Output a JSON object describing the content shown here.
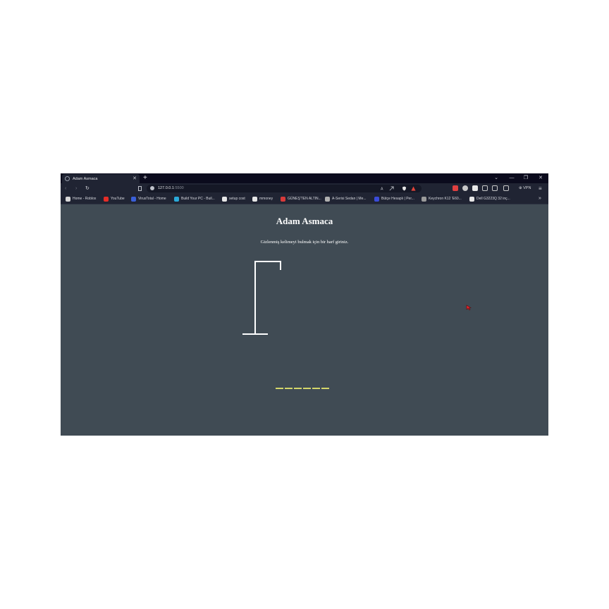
{
  "browser": {
    "tab_title": "Adam Asmaca",
    "tab_close": "✕",
    "new_tab": "+",
    "window_controls": [
      "⌄",
      "—",
      "❐",
      "✕"
    ],
    "url_host": "127.0.0.1",
    "url_port": ":5500",
    "vpn_label": "⊕ VPN",
    "menu_icon": "≡",
    "nav": {
      "back": "‹",
      "forward": "›",
      "reload": "↻"
    }
  },
  "bookmarks": [
    {
      "label": "Home - Roblox",
      "icon_color": "#d8d8d8"
    },
    {
      "label": "YouTube",
      "icon_color": "#e52d27"
    },
    {
      "label": "VirusTotal - Home",
      "icon_color": "#3a5fd8"
    },
    {
      "label": "Build Your PC - Buil...",
      "icon_color": "#2aa9d8"
    },
    {
      "label": "setup cost",
      "icon_color": "#e6e6e6"
    },
    {
      "label": "mmoney",
      "icon_color": "#e6e6e6"
    },
    {
      "label": "GÜNEŞ'TEN ALTIN...",
      "icon_color": "#d83a3a"
    },
    {
      "label": "A-Serisi Sedan | Me...",
      "icon_color": "#b0b0b0"
    },
    {
      "label": "Bütçe Hesaplı | Per...",
      "icon_color": "#3a4bd8"
    },
    {
      "label": "Keychron K12 'E60...",
      "icon_color": "#9a9a9a"
    },
    {
      "label": "Dell G3223Q 32 inç...",
      "icon_color": "#e6e6e6"
    }
  ],
  "bookmarks_more": "»",
  "game": {
    "title": "Adam Asmaca",
    "instruction": "Gizlenmiş kelimeyi bulmak için bir harf giriniz.",
    "letter_slots": 6,
    "slot_color": "#d4d66a"
  },
  "colors": {
    "page_background": "#404b54",
    "tab_bar": "#0b0b1d",
    "toolbar": "#202433"
  }
}
